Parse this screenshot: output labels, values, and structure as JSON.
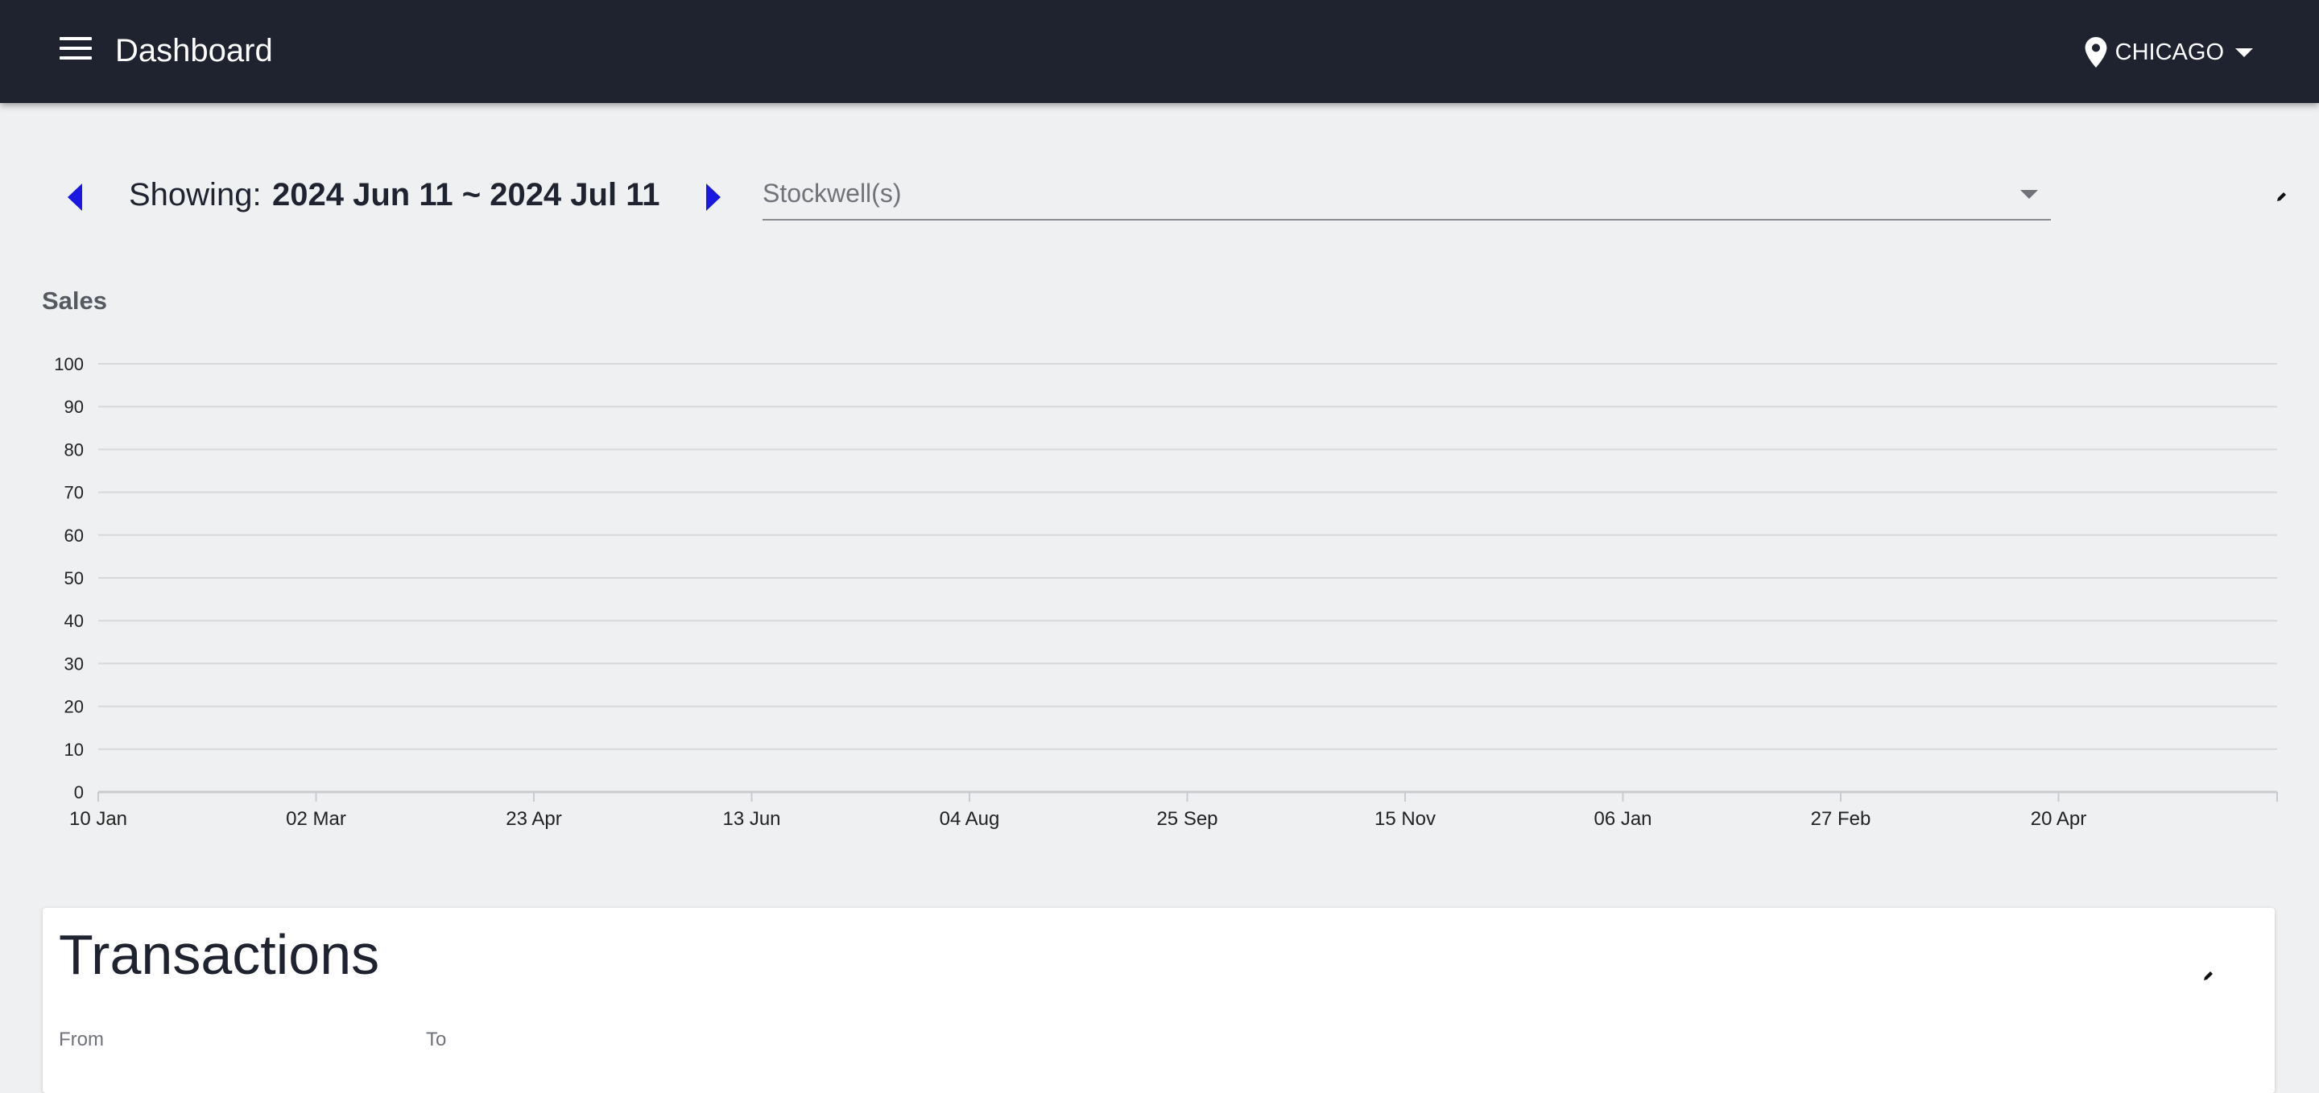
{
  "header": {
    "title": "Dashboard",
    "location": "CHICAGO",
    "menu_icon": "hamburger-menu-icon",
    "location_icon": "map-pin-icon"
  },
  "range": {
    "label": "Showing:",
    "value": "2024 Jun 11 ~ 2024 Jul 11",
    "accent_color": "#1a17e0"
  },
  "stockwell": {
    "placeholder": "Stockwell(s)"
  },
  "sales": {
    "title": "Sales"
  },
  "chart_data": {
    "type": "line",
    "title": "Sales",
    "xlabel": "",
    "ylabel": "",
    "ylim": [
      0,
      100
    ],
    "yticks": [
      0,
      10,
      20,
      30,
      40,
      50,
      60,
      70,
      80,
      90,
      100
    ],
    "xticks": [
      "10 Jan",
      "02 Mar",
      "23 Apr",
      "13 Jun",
      "04 Aug",
      "25 Sep",
      "15 Nov",
      "06 Jan",
      "27 Feb",
      "20 Apr"
    ],
    "series": [],
    "grid": true
  },
  "transactions": {
    "title": "Transactions",
    "from_label": "From",
    "to_label": "To"
  }
}
